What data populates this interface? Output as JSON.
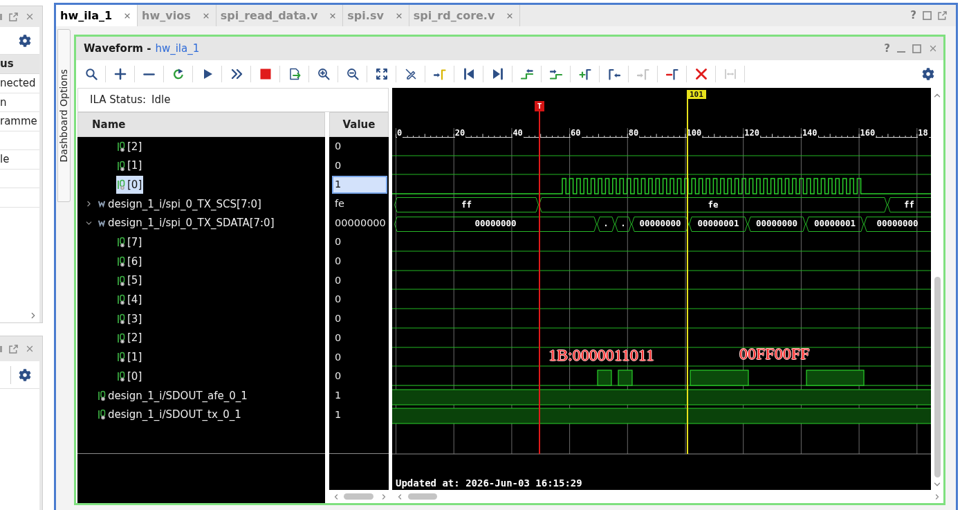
{
  "side_panel": {
    "column_header": "us",
    "rows": [
      {
        "text": "nected"
      },
      {
        "text": "n"
      },
      {
        "text": "ramme"
      },
      {},
      {
        "text": "le"
      },
      {},
      {}
    ]
  },
  "editor": {
    "tabs": [
      {
        "label": "hw_ila_1",
        "selected": true
      },
      {
        "label": "hw_vios",
        "selected": false
      },
      {
        "label": "spi_read_data.v",
        "selected": false
      },
      {
        "label": "spi.sv",
        "selected": false
      },
      {
        "label": "spi_rd_core.v",
        "selected": false
      }
    ],
    "help": "?"
  },
  "side_tab": {
    "label": "Dashboard Options"
  },
  "waveform_window": {
    "title": "Waveform -",
    "source": "hw_ila_1",
    "help": "?"
  },
  "toolbar": [
    {
      "kind": "search",
      "disabled": false
    },
    {
      "kind": "add",
      "disabled": false
    },
    {
      "kind": "remove",
      "disabled": false
    },
    {
      "kind": "rerun",
      "disabled": false
    },
    {
      "kind": "play",
      "disabled": false
    },
    {
      "kind": "forward",
      "disabled": false
    },
    {
      "kind": "stop",
      "disabled": false
    },
    {
      "kind": "export",
      "disabled": false
    },
    {
      "kind": "zoomin",
      "disabled": false
    },
    {
      "kind": "zoomout",
      "disabled": false
    },
    {
      "kind": "fit",
      "disabled": false
    },
    {
      "kind": "nocursor",
      "disabled": false
    },
    {
      "kind": "tocursor",
      "disabled": false
    },
    {
      "kind": "first",
      "disabled": false
    },
    {
      "kind": "last",
      "disabled": false
    },
    {
      "kind": "prevedge",
      "disabled": false
    },
    {
      "kind": "nextedge",
      "disabled": false
    },
    {
      "kind": "addmarker",
      "disabled": false
    },
    {
      "kind": "prevmarker",
      "disabled": false
    },
    {
      "kind": "nextmarker",
      "disabled": true
    },
    {
      "kind": "delmarker",
      "disabled": false
    },
    {
      "kind": "delete",
      "disabled": false
    },
    {
      "kind": "measure",
      "disabled": true
    },
    {
      "kind": "settings",
      "disabled": false
    }
  ],
  "ila_status": {
    "label": "ILA Status:",
    "value": "Idle"
  },
  "columns": [
    "Name",
    "Value"
  ],
  "signals": [
    {
      "kind": "group",
      "children": [
        {
          "name": "[2]",
          "value": "0",
          "kind": "bit",
          "selected": false
        },
        {
          "name": "[1]",
          "value": "0",
          "kind": "bit",
          "selected": false
        },
        {
          "name": "[0]",
          "value": "1",
          "kind": "bit",
          "selected": true
        }
      ]
    },
    {
      "name": "design_1_i/spi_0_TX_SCS[7:0]",
      "value": "fe",
      "kind": "bus",
      "expanded": false,
      "selected": false,
      "wave": [
        {
          "label": "ff"
        },
        {
          "label": "fe"
        },
        {
          "label": "ff"
        }
      ]
    },
    {
      "name": "design_1_i/spi_0_TX_SDATA[7:0]",
      "value": "00000000",
      "kind": "bus",
      "expanded": true,
      "selected": false,
      "wave": [
        {
          "label": "00000000"
        },
        {
          "label": "."
        },
        {
          "label": "."
        },
        {
          "label": "00000000"
        },
        {
          "label": "00000001"
        },
        {
          "label": "00000000"
        },
        {
          "label": "00000001"
        },
        {
          "label": "00000000"
        }
      ],
      "children": [
        {
          "name": "[7]",
          "value": "0",
          "kind": "bit",
          "selected": false
        },
        {
          "name": "[6]",
          "value": "0",
          "kind": "bit",
          "selected": false
        },
        {
          "name": "[5]",
          "value": "0",
          "kind": "bit",
          "selected": false
        },
        {
          "name": "[4]",
          "value": "0",
          "kind": "bit",
          "selected": false
        },
        {
          "name": "[3]",
          "value": "0",
          "kind": "bit",
          "selected": false
        },
        {
          "name": "[2]",
          "value": "0",
          "kind": "bit",
          "selected": false
        },
        {
          "name": "[1]",
          "value": "0",
          "kind": "bit",
          "selected": false
        },
        {
          "name": "[0]",
          "value": "0",
          "kind": "bit",
          "selected": false
        }
      ]
    },
    {
      "name": "design_1_i/SDOUT_afe_0_1",
      "value": "1",
      "kind": "bit",
      "selected": false
    },
    {
      "name": "design_1_i/SDOUT_tx_0_1",
      "value": "1",
      "kind": "bit",
      "selected": false
    }
  ],
  "ruler": {
    "ticks": [
      "0",
      "20",
      "40",
      "60",
      "80",
      "100",
      "120",
      "140",
      "160",
      "18"
    ]
  },
  "markers": [
    {
      "kind": "trigger",
      "label": "T"
    },
    {
      "kind": "cursor",
      "label": "101"
    }
  ],
  "annotations": [
    {
      "text": "1B:0000011011"
    },
    {
      "text": "00FF00FF"
    }
  ],
  "updated": "Updated at: 2026-Jun-03 16:15:29"
}
